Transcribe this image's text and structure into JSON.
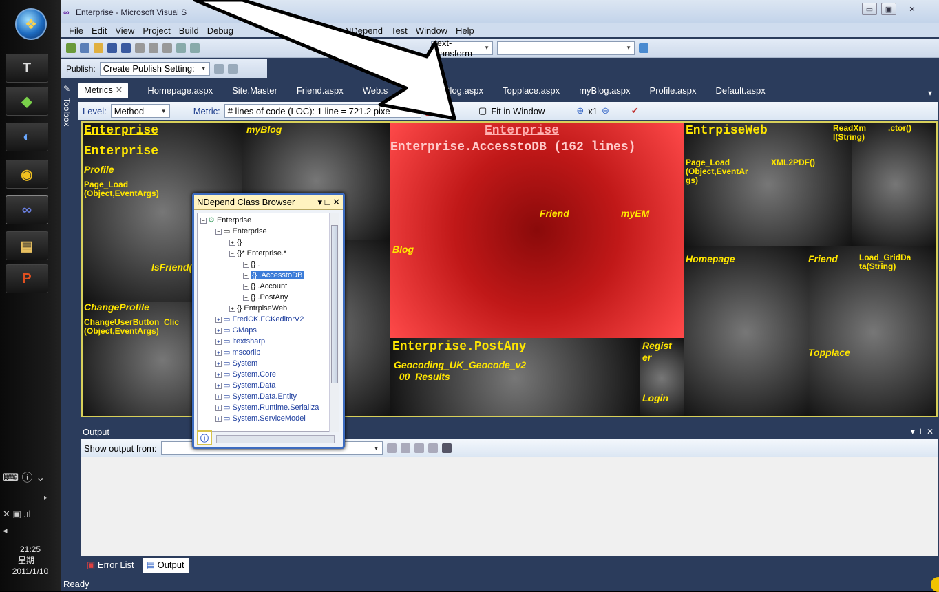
{
  "window": {
    "title": "Enterprise - Microsoft Visual S"
  },
  "menu": [
    "File",
    "Edit",
    "View",
    "Project",
    "Build",
    "Debug",
    "NDepend",
    "Test",
    "Window",
    "Help"
  ],
  "toolbar": {
    "combo_text": "text-transform"
  },
  "publish": {
    "label": "Publish:",
    "combo": "Create Publish Setting:"
  },
  "tabs": [
    "Metrics",
    "Homepage.aspx",
    "Site.Master",
    "Friend.aspx",
    "Web.s",
    "iewBlog.aspx",
    "Topplace.aspx",
    "myBlog.aspx",
    "Profile.aspx",
    "Default.aspx"
  ],
  "toolbox_label": "Toolbox",
  "metrics": {
    "level_label": "Level:",
    "level_value": "Method",
    "metric_label": "Metric:",
    "metric_value": "# lines of code (LOC):  1 line = 721.2 pixe",
    "fit_label": "Fit in Window",
    "zoom": "x1"
  },
  "treemap": {
    "labels": {
      "enterprise_top": "Enterprise",
      "enterprise_sub": "Enterprise",
      "profile": "Profile",
      "page_load": "Page_Load\n(Object,EventArgs)",
      "isfriend": "IsFriend(",
      "changeprofile": "ChangeProfile",
      "changeuser": "ChangeUserButton_Clic\n(Object,EventArgs)",
      "myblog": "myBlog",
      "red_title": "Enterprise",
      "red_sub": "Enterprise.AccesstoDB (162 lines)",
      "friend": "Friend",
      "myem": "myEM",
      "blog": "Blog",
      "postany": "Enterprise.PostAny",
      "geocoding": "Geocoding_UK_Geocode_v2\n_00_Results",
      "register": "Regist\ner",
      "login": "Login",
      "entrpiseweb": "EntrpiseWeb",
      "readxml": "ReadXm\nl(String)",
      "ctor": ".ctor()",
      "page_load2": "Page_Load\n(Object,EventAr\ngs)",
      "xml2pdf": "XML2PDF()",
      "homepage": "Homepage",
      "friend2": "Friend",
      "loadgrid": "Load_GridDa\nta(String)",
      "topplace": "Topplace"
    }
  },
  "browser": {
    "title": "NDepend Class Browser",
    "nodes": [
      "Enterprise",
      "Enterprise",
      "{}",
      "{}* Enterprise.*",
      "{} .",
      "{} .AccesstoDB",
      "{} .Account",
      "{} .PostAny",
      "{} EntrpiseWeb",
      "FredCK.FCKeditorV2",
      "GMaps",
      "itextsharp",
      "mscorlib",
      "System",
      "System.Core",
      "System.Data",
      "System.Data.Entity",
      "System.Runtime.Serializa",
      "System.ServiceModel"
    ],
    "selected": ".AccesstoDB"
  },
  "output": {
    "title": "Output",
    "show_from": "Show output from:"
  },
  "bottom_tabs": [
    "Error List",
    "Output"
  ],
  "status": "Ready",
  "clock": {
    "time": "21:25",
    "day": "星期一",
    "date": "2011/1/10"
  },
  "colors": {
    "accent": "#2b3c5c",
    "treemap_label": "#ffe600",
    "hot": "#ff4a4a"
  }
}
